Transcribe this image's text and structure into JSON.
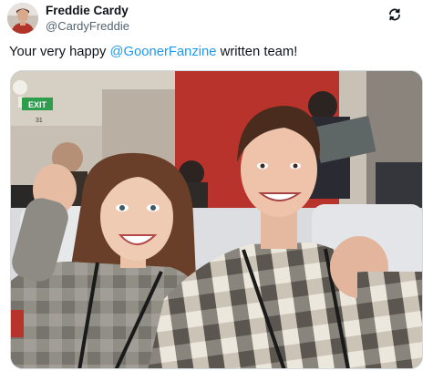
{
  "author": {
    "display_name": "Freddie Cardy",
    "handle": "@CardyFreddie",
    "avatar_icon": "user-avatar-photo"
  },
  "header": {
    "more_icon": "circular-arrows-icon"
  },
  "post": {
    "text_before": "Your very happy ",
    "mention": "@GoonerFanzine",
    "text_after": " written team!"
  },
  "media": {
    "exit_sign": "EXIT",
    "row_number": "31"
  },
  "colors": {
    "mention": "#1d9bf0",
    "text": "#0f1419",
    "secondary": "#536471",
    "stadium_red": "#b52a24"
  }
}
